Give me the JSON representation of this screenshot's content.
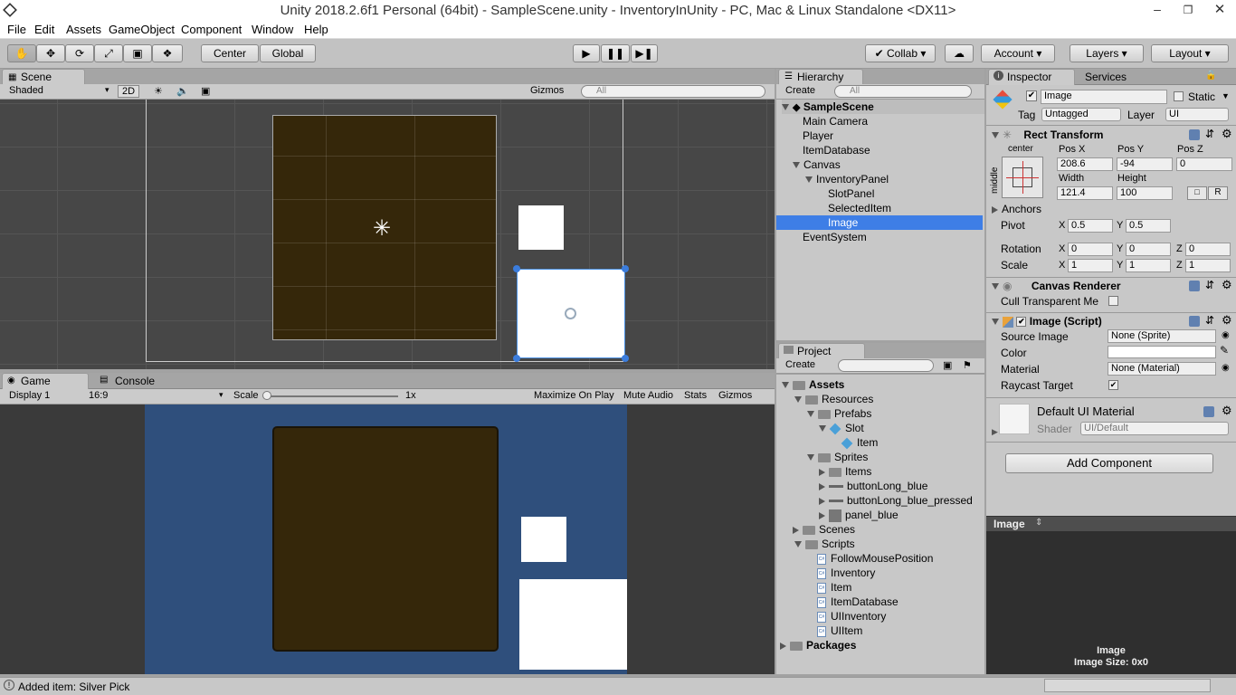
{
  "window": {
    "title": "Unity 2018.2.6f1 Personal (64bit) - SampleScene.unity - InventoryInUnity - PC, Mac & Linux Standalone <DX11>"
  },
  "menu": [
    "File",
    "Edit",
    "Assets",
    "GameObject",
    "Component",
    "Window",
    "Help"
  ],
  "toolbar": {
    "center": "Center",
    "global": "Global",
    "collab": "Collab",
    "account": "Account",
    "layers": "Layers",
    "layout": "Layout"
  },
  "scene": {
    "tab": "Scene",
    "shading": "Shaded",
    "mode2d": "2D",
    "gizmos": "Gizmos",
    "search_placeholder": "All"
  },
  "game": {
    "tab": "Game",
    "console_tab": "Console",
    "display": "Display 1",
    "aspect": "16:9",
    "scale_label": "Scale",
    "scale_value": "1x",
    "maximize": "Maximize On Play",
    "mute": "Mute Audio",
    "stats": "Stats",
    "gizmos": "Gizmos"
  },
  "hierarchy": {
    "tab": "Hierarchy",
    "create": "Create",
    "search_placeholder": "All",
    "scene": "SampleScene",
    "items": [
      {
        "label": "Main Camera"
      },
      {
        "label": "Player"
      },
      {
        "label": "ItemDatabase"
      },
      {
        "label": "Canvas"
      },
      {
        "label": "InventoryPanel"
      },
      {
        "label": "SlotPanel"
      },
      {
        "label": "SelectedItem"
      },
      {
        "label": "Image"
      },
      {
        "label": "EventSystem"
      }
    ]
  },
  "project": {
    "tab": "Project",
    "create": "Create",
    "items": [
      {
        "label": "Assets"
      },
      {
        "label": "Resources"
      },
      {
        "label": "Prefabs"
      },
      {
        "label": "Slot"
      },
      {
        "label": "Item"
      },
      {
        "label": "Sprites"
      },
      {
        "label": "Items"
      },
      {
        "label": "buttonLong_blue"
      },
      {
        "label": "buttonLong_blue_pressed"
      },
      {
        "label": "panel_blue"
      },
      {
        "label": "Scenes"
      },
      {
        "label": "Scripts"
      },
      {
        "label": "FollowMousePosition"
      },
      {
        "label": "Inventory"
      },
      {
        "label": "Item"
      },
      {
        "label": "ItemDatabase"
      },
      {
        "label": "UIInventory"
      },
      {
        "label": "UIItem"
      },
      {
        "label": "Packages"
      }
    ]
  },
  "inspector": {
    "tab": "Inspector",
    "services_tab": "Services",
    "name": "Image",
    "static": "Static",
    "tag_label": "Tag",
    "tag": "Untagged",
    "layer_label": "Layer",
    "layer": "UI",
    "rect": {
      "title": "Rect Transform",
      "anchor_h": "center",
      "anchor_v": "middle",
      "posx_label": "Pos X",
      "posy_label": "Pos Y",
      "posz_label": "Pos Z",
      "posx": "208.6",
      "posy": "-94",
      "posz": "0",
      "width_label": "Width",
      "height_label": "Height",
      "width": "121.4",
      "height": "100",
      "anchors": "Anchors",
      "pivot": "Pivot",
      "pivot_x": "0.5",
      "pivot_y": "0.5",
      "rotation": "Rotation",
      "rot_x": "0",
      "rot_y": "0",
      "rot_z": "0",
      "scale": "Scale",
      "scale_x": "1",
      "scale_y": "1",
      "scale_z": "1",
      "x": "X",
      "y": "Y",
      "z": "Z",
      "r": "R"
    },
    "canvas_renderer": {
      "title": "Canvas Renderer",
      "cull": "Cull Transparent Me"
    },
    "image": {
      "title": "Image (Script)",
      "source_label": "Source Image",
      "source": "None (Sprite)",
      "color_label": "Color",
      "material_label": "Material",
      "material": "None (Material)",
      "raycast": "Raycast Target"
    },
    "material": {
      "title": "Default UI Material",
      "shader_label": "Shader",
      "shader": "UI/Default"
    },
    "add_component": "Add Component",
    "preview": {
      "title": "Image",
      "caption": "Image",
      "size": "Image Size: 0x0"
    }
  },
  "status": {
    "message": "Added item: Silver Pick"
  }
}
